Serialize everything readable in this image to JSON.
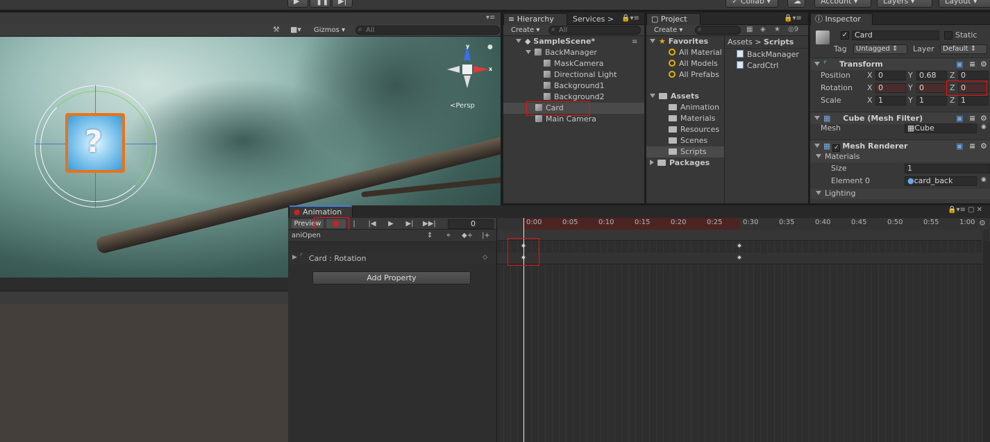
{
  "toolbar": {
    "collab": "Collab ▾",
    "account": "Account ▾",
    "layers": "Layers ▾",
    "layout": "Layout ▾"
  },
  "scene": {
    "gizmos": "Gizmos",
    "search_placeholder": "All",
    "persp": "<Persp"
  },
  "hierarchy": {
    "tab": "Hierarchy",
    "services_tab": "Services",
    "create": "Create ▾",
    "search_placeholder": "All",
    "scene_name": "SampleScene*",
    "items": [
      {
        "label": "BackManager"
      },
      {
        "label": "MaskCamera"
      },
      {
        "label": "Directional Light"
      },
      {
        "label": "Background1"
      },
      {
        "label": "Background2"
      },
      {
        "label": "Card"
      },
      {
        "label": "Main Camera"
      }
    ]
  },
  "project": {
    "tab": "Project",
    "create": "Create ▾",
    "hidden_count": "9",
    "favorites": "Favorites",
    "fav_items": [
      "All Material",
      "All Models",
      "All Prefabs"
    ],
    "assets": "Assets",
    "asset_folders": [
      "Animation",
      "Materials",
      "Resources",
      "Scenes",
      "Scripts"
    ],
    "packages": "Packages",
    "breadcrumb_root": "Assets",
    "breadcrumb_leaf": "Scripts",
    "files": [
      "BackManager",
      "CardCtrl"
    ]
  },
  "inspector": {
    "tab": "Inspector",
    "object_name": "Card",
    "static": "Static",
    "tag_label": "Tag",
    "tag_value": "Untagged",
    "layer_label": "Layer",
    "layer_value": "Default",
    "transform": {
      "title": "Transform",
      "position_label": "Position",
      "rotation_label": "Rotation",
      "scale_label": "Scale",
      "position": {
        "x": "0",
        "y": "0.68",
        "z": "0"
      },
      "rotation": {
        "x": "0",
        "y": "0",
        "z": "0"
      },
      "scale": {
        "x": "1",
        "y": "1",
        "z": "1"
      }
    },
    "mesh_filter": {
      "title": "Cube (Mesh Filter)",
      "mesh_label": "Mesh",
      "mesh_value": "Cube"
    },
    "mesh_renderer": {
      "title": "Mesh Renderer",
      "materials": "Materials",
      "size_label": "Size",
      "size_value": "1",
      "element_label": "Element 0",
      "element_value": "card_back"
    },
    "lighting": "Lighting"
  },
  "animation": {
    "tab": "Animation",
    "preview": "Preview",
    "frame": "0",
    "clip": "aniOpen",
    "property": "Card : Rotation",
    "add_property": "Add Property",
    "ticks": [
      "0:00",
      "0:05",
      "0:10",
      "0:15",
      "0:20",
      "0:25",
      "0:30",
      "0:35",
      "0:40",
      "0:45",
      "0:50",
      "0:55",
      "1:00"
    ]
  },
  "colors": {
    "record_red": "#c72222",
    "selection": "#4a4a4a",
    "timeline_recording": "#4d2424"
  }
}
